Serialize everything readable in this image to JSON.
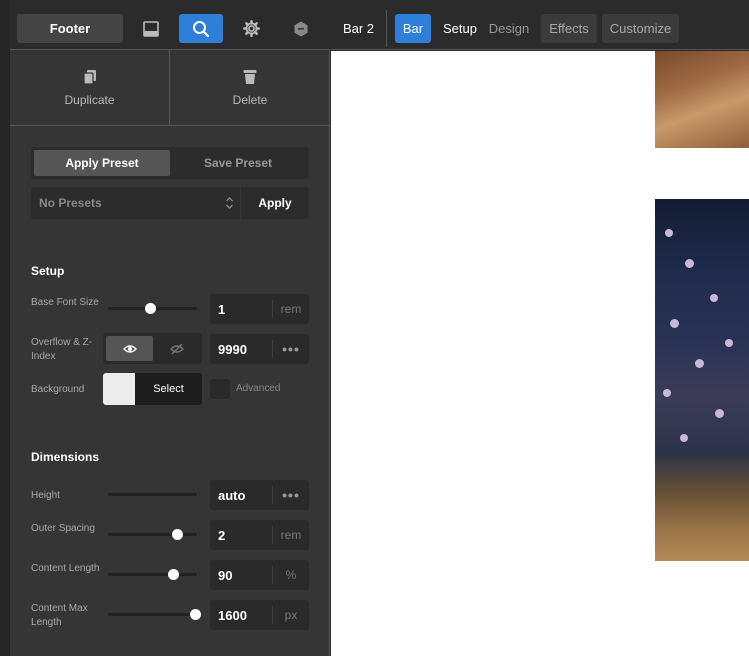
{
  "left_topbar": {
    "element_label": "Footer",
    "icons": [
      "panel-icon",
      "search-icon",
      "gear-icon",
      "hexagon-icon"
    ]
  },
  "actions": {
    "duplicate_label": "Duplicate",
    "delete_label": "Delete"
  },
  "presets": {
    "apply_tab": "Apply Preset",
    "save_tab": "Save Preset",
    "select_value": "No Presets",
    "apply_button": "Apply"
  },
  "setup": {
    "title": "Setup",
    "base_font": {
      "label": "Base Font Size",
      "value": "1",
      "unit": "rem",
      "slider": 0.5
    },
    "overflow": {
      "label": "Overflow & Z-Index",
      "value": "9990",
      "more": "•••"
    },
    "background": {
      "label": "Background",
      "select_label": "Select",
      "swatch_color": "#ececec",
      "advanced_label": "Advanced"
    }
  },
  "dimensions": {
    "title": "Dimensions",
    "height": {
      "label": "Height",
      "value": "auto",
      "more": "•••"
    },
    "outer_spacing": {
      "label": "Outer Spacing",
      "value": "2",
      "unit": "rem",
      "slider": 0.8
    },
    "content_length": {
      "label": "Content Length",
      "value": "90",
      "unit": "%",
      "slider": 0.75
    },
    "content_max_length": {
      "label": "Content Max Length",
      "value": "1600",
      "unit": "px",
      "slider": 1.0
    }
  },
  "right_topbar": {
    "bar_name": "Bar 2",
    "tabs": [
      {
        "label": "Bar",
        "active": true
      },
      {
        "label": "Setup"
      },
      {
        "label": "Design"
      },
      {
        "label": "Effects"
      },
      {
        "label": "Customize"
      }
    ]
  },
  "colors": {
    "accent": "#2e7fd8",
    "panel": "#353535",
    "canvas": "#ffffff"
  }
}
